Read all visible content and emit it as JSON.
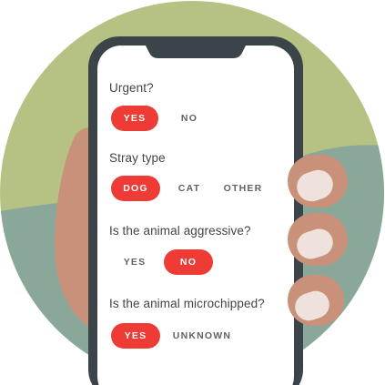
{
  "colors": {
    "accent": "#ee3b35",
    "background_green": "#b5c283",
    "background_sage": "#8aa89a",
    "skin": "#c99179",
    "phone_frame": "#3b4549"
  },
  "form": {
    "questions": [
      {
        "label": "Urgent?",
        "options": [
          {
            "label": "YES",
            "selected": true
          },
          {
            "label": "NO",
            "selected": false
          }
        ]
      },
      {
        "label": "Stray type",
        "options": [
          {
            "label": "DOG",
            "selected": true
          },
          {
            "label": "CAT",
            "selected": false
          },
          {
            "label": "OTHER",
            "selected": false
          }
        ]
      },
      {
        "label": "Is the animal aggressive?",
        "options": [
          {
            "label": "YES",
            "selected": false
          },
          {
            "label": "NO",
            "selected": true
          }
        ]
      },
      {
        "label": "Is the animal microchipped?",
        "options": [
          {
            "label": "YES",
            "selected": true
          },
          {
            "label": "UNKNOWN",
            "selected": false
          }
        ]
      }
    ]
  }
}
